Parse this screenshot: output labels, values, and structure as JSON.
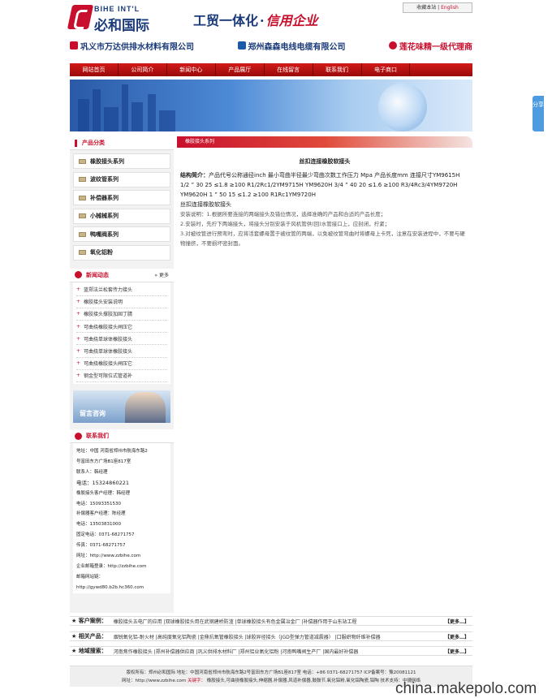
{
  "header": {
    "logo_en": "BIHE INT'L",
    "logo_cn": "必和国际",
    "slogan_left": "工贸一体化",
    "slogan_dot": "·",
    "slogan_right": "信用企业",
    "favorite_label": "收藏本站",
    "sep": "|",
    "english_label": "English"
  },
  "partners": [
    {
      "label": "巩义市万达供排水材料有限公司",
      "color": "#c8102e"
    },
    {
      "label": "郑州森森电线电缆有限公司",
      "color": "#1a5aa8"
    },
    {
      "label": "莲花味精一级代理商",
      "color": "#c8102e"
    }
  ],
  "nav": [
    "网站首页",
    "公司简介",
    "新闻中心",
    "产品展厅",
    "在线留言",
    "联系我们",
    "电子商口"
  ],
  "side_tab": "分享",
  "products": {
    "title": "产品分类",
    "items": [
      "橡胶接头系列",
      "波纹管系列",
      "补偿器系列",
      "小械械系列",
      "鸭嘴阀系列",
      "氧化铝粉"
    ]
  },
  "news": {
    "title": "新闻动态",
    "more": "更多",
    "items": [
      "蓝郑法兰松套传力接头",
      "橡胶接头安装说明",
      "橡胶接头撑胶加固丁腈",
      "可曲挠橡胶接头闸压它",
      "可曲挠单球体橡胶接头",
      "可曲挠单球体橡胶接头",
      "可曲挠橡胶接头闸压它",
      "钢金型可限位式管道补"
    ]
  },
  "message_banner": "留言咨询",
  "contact": {
    "title": "联系我们",
    "lines": [
      "地址：中国 河南省郑州市航海东路2",
      "号富田东方广场B1座817室",
      "联系人：韩经理",
      "电话：15324860221",
      "橡胶接头客户经理：韩经理",
      "电话：15093351530",
      "补偿器客户经理：陈经理",
      "电话：13503831000",
      "固定电话：0371-68271757",
      "传真：0371-68271757",
      "网址：http://www.zzbihe.com",
      "企业邮箱登录：http://zzbihe.com",
      "邮箱网站链：",
      "http://gywd80.b2b.hc360.com"
    ]
  },
  "article": {
    "crumb": "橡胶接头系列",
    "title": "丝扣连接橡胶软接头",
    "intro_label": "结构简介：",
    "intro_text": "产品代号公称通径inch 最小弯曲半径最少弯曲次数工作压力 Mpa 产品长度mm 连接尺寸YM9615H 1/2 ” 30 25 ≤1.8 ≥100 R1/2Rc1/2YM9715H YM9620H 3/4 ” 40 20 ≤1.6 ≥100 R3/4Rc3/4YM9720H YM9620H 1 ” 50 15 ≤1.2 ≥100 R1Rc1YM9720H",
    "sub": "丝扣连接橡胶软接头",
    "install": [
      "安装说明：1.根据所要连接的两端接头及错位情况，选择准确的产品和合适的产品长度；",
      "2.安装时，先拧下两端接头，将接头分别安装于风机管供(回)水管接口上，应封闭，拧紧；",
      "3.对被纹管进行预弯时，应将活套螺母置于被纹管的两端，以免被纹管弯曲时将螺母上卡死，注意在安装进程中，不要与硬物撞挤，不要损坏密封面。"
    ]
  },
  "footer_bars": [
    {
      "label": "★ 客户案例：",
      "links": "橡胶接头五电厂的应用 |双球橡胶接头用在武钢建桥防渣 |单球橡胶接头有色金属冶金厂 |补偿器作用于山东站工程",
      "more": "【更多…】"
    },
    {
      "label": "★ 相关产品：",
      "links": "烟锐氧化铝-耐火材 |高纯度氧化铝陶瓷 |金鼎抗氧管橡胶接头 |球胶异径接头（JGD型弹力管道减震器） |口服织物纤维补偿器",
      "more": "【更多…】"
    },
    {
      "label": "★ 地域搜索：",
      "links": "河南焦作橡胶接头 |郑州补偿器供应商 |巩义供排水材料厂 |郑州铝业氧化铝粉 |河南鸭嘴阀生产厂 |国内最好补偿器",
      "more": "【更多…】"
    }
  ],
  "footer": {
    "line1": "版权所有：郑州必和国际   地址：中国河南省郑州市航海东路2号富田东方广场B1座817室   电话：+86 0371-68271757 ICP备案号：豫20081121",
    "line2_prefix": "网址：http://www.zzbihe.com",
    "keywords_label": "关键字：",
    "line2_rest": "橡胶接头,可曲挠橡胶接头,伸缩器,补偿器,风道补偿器,鼓鼓节,氧化铝粉,氧化铝陶瓷,铝陶 技术支持：中捷网络"
  },
  "watermark": "china.makepolo.com"
}
